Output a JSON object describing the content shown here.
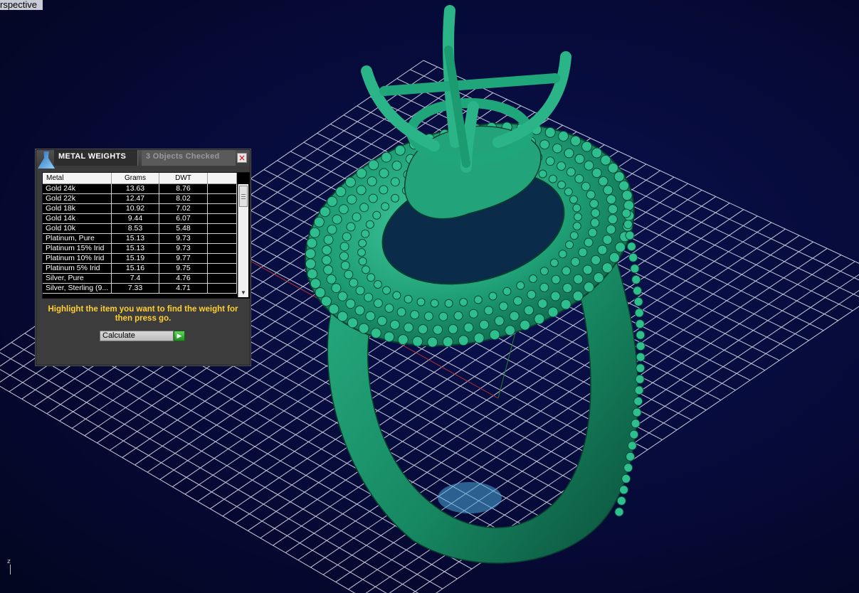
{
  "viewport": {
    "label": "rspective",
    "axis_label": "z"
  },
  "dialog": {
    "title": "METAL WEIGHTS",
    "status": "3 Objects Checked",
    "close_glyph": "×",
    "icon": "flask-icon",
    "table": {
      "headers": {
        "metal": "Metal",
        "grams": "Grams",
        "dwt": "DWT"
      },
      "rows": [
        {
          "metal": "Gold 24k",
          "grams": "13.63",
          "dwt": "8.76"
        },
        {
          "metal": "Gold 22k",
          "grams": "12.47",
          "dwt": "8.02"
        },
        {
          "metal": "Gold 18k",
          "grams": "10.92",
          "dwt": "7.02"
        },
        {
          "metal": "Gold 14k",
          "grams": "9.44",
          "dwt": "6.07"
        },
        {
          "metal": "Gold 10k",
          "grams": "8.53",
          "dwt": "5.48"
        },
        {
          "metal": "Platinum, Pure",
          "grams": "15.13",
          "dwt": "9.73"
        },
        {
          "metal": "Platinum 15% Irid",
          "grams": "15.13",
          "dwt": "9.73"
        },
        {
          "metal": "Platinum 10% Irid",
          "grams": "15.19",
          "dwt": "9.77"
        },
        {
          "metal": "Platinum 5% Irid",
          "grams": "15.16",
          "dwt": "9.75"
        },
        {
          "metal": "Silver, Pure",
          "grams": "7.4",
          "dwt": "4.76"
        },
        {
          "metal": "Silver, Sterling (9...",
          "grams": "7.33",
          "dwt": "4.71"
        }
      ]
    },
    "hint": "Highlight the item you want to find the weight for then press go.",
    "action": {
      "selected": "Calculate",
      "go_glyph": "▶"
    }
  },
  "colors": {
    "background": "#060a38",
    "grid": "#ffffff",
    "model": "#1fa67a",
    "hint_text": "#ffcf33",
    "go_button": "#2fb52f"
  }
}
